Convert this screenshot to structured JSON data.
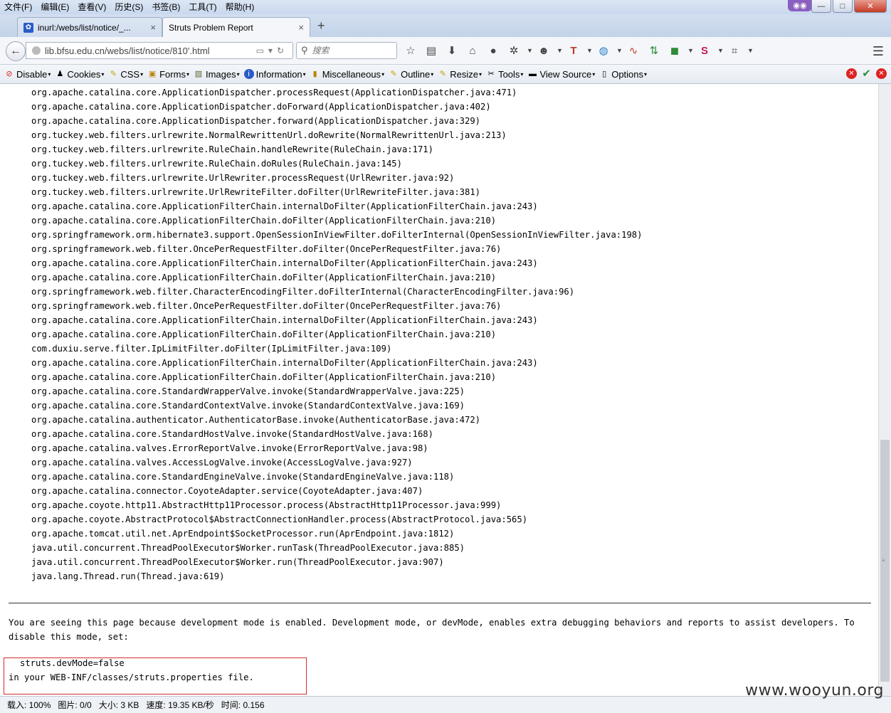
{
  "menu": [
    "文件(F)",
    "编辑(E)",
    "查看(V)",
    "历史(S)",
    "书签(B)",
    "工具(T)",
    "帮助(H)"
  ],
  "tabs": [
    {
      "label": "inurl:/webs/list/notice/_...",
      "close": "×"
    },
    {
      "label": "Struts Problem Report",
      "close": "×"
    }
  ],
  "newtab": "+",
  "address": {
    "url": "lib.bfsu.edu.cn/webs/list/notice/810'.html"
  },
  "search": {
    "placeholder": "搜索"
  },
  "devtoolbar": [
    "Disable",
    "Cookies",
    "CSS",
    "Forms",
    "Images",
    "Information",
    "Miscellaneous",
    "Outline",
    "Resize",
    "Tools",
    "View Source",
    "Options"
  ],
  "stack_trace": [
    "org.apache.catalina.core.ApplicationDispatcher.processRequest(ApplicationDispatcher.java:471)",
    "org.apache.catalina.core.ApplicationDispatcher.doForward(ApplicationDispatcher.java:402)",
    "org.apache.catalina.core.ApplicationDispatcher.forward(ApplicationDispatcher.java:329)",
    "org.tuckey.web.filters.urlrewrite.NormalRewrittenUrl.doRewrite(NormalRewrittenUrl.java:213)",
    "org.tuckey.web.filters.urlrewrite.RuleChain.handleRewrite(RuleChain.java:171)",
    "org.tuckey.web.filters.urlrewrite.RuleChain.doRules(RuleChain.java:145)",
    "org.tuckey.web.filters.urlrewrite.UrlRewriter.processRequest(UrlRewriter.java:92)",
    "org.tuckey.web.filters.urlrewrite.UrlRewriteFilter.doFilter(UrlRewriteFilter.java:381)",
    "org.apache.catalina.core.ApplicationFilterChain.internalDoFilter(ApplicationFilterChain.java:243)",
    "org.apache.catalina.core.ApplicationFilterChain.doFilter(ApplicationFilterChain.java:210)",
    "org.springframework.orm.hibernate3.support.OpenSessionInViewFilter.doFilterInternal(OpenSessionInViewFilter.java:198)",
    "org.springframework.web.filter.OncePerRequestFilter.doFilter(OncePerRequestFilter.java:76)",
    "org.apache.catalina.core.ApplicationFilterChain.internalDoFilter(ApplicationFilterChain.java:243)",
    "org.apache.catalina.core.ApplicationFilterChain.doFilter(ApplicationFilterChain.java:210)",
    "org.springframework.web.filter.CharacterEncodingFilter.doFilterInternal(CharacterEncodingFilter.java:96)",
    "org.springframework.web.filter.OncePerRequestFilter.doFilter(OncePerRequestFilter.java:76)",
    "org.apache.catalina.core.ApplicationFilterChain.internalDoFilter(ApplicationFilterChain.java:243)",
    "org.apache.catalina.core.ApplicationFilterChain.doFilter(ApplicationFilterChain.java:210)",
    "com.duxiu.serve.filter.IpLimitFilter.doFilter(IpLimitFilter.java:109)",
    "org.apache.catalina.core.ApplicationFilterChain.internalDoFilter(ApplicationFilterChain.java:243)",
    "org.apache.catalina.core.ApplicationFilterChain.doFilter(ApplicationFilterChain.java:210)",
    "org.apache.catalina.core.StandardWrapperValve.invoke(StandardWrapperValve.java:225)",
    "org.apache.catalina.core.StandardContextValve.invoke(StandardContextValve.java:169)",
    "org.apache.catalina.authenticator.AuthenticatorBase.invoke(AuthenticatorBase.java:472)",
    "org.apache.catalina.core.StandardHostValve.invoke(StandardHostValve.java:168)",
    "org.apache.catalina.valves.ErrorReportValve.invoke(ErrorReportValve.java:98)",
    "org.apache.catalina.valves.AccessLogValve.invoke(AccessLogValve.java:927)",
    "org.apache.catalina.core.StandardEngineValve.invoke(StandardEngineValve.java:118)",
    "org.apache.catalina.connector.CoyoteAdapter.service(CoyoteAdapter.java:407)",
    "org.apache.coyote.http11.AbstractHttp11Processor.process(AbstractHttp11Processor.java:999)",
    "org.apache.coyote.AbstractProtocol$AbstractConnectionHandler.process(AbstractProtocol.java:565)",
    "org.apache.tomcat.util.net.AprEndpoint$SocketProcessor.run(AprEndpoint.java:1812)",
    "java.util.concurrent.ThreadPoolExecutor$Worker.runTask(ThreadPoolExecutor.java:885)",
    "java.util.concurrent.ThreadPoolExecutor$Worker.run(ThreadPoolExecutor.java:907)",
    "java.lang.Thread.run(Thread.java:619)"
  ],
  "devmode_message": "You are seeing this page because development mode is enabled. Development mode, or devMode, enables extra debugging behaviors and reports to assist developers. To disable this mode, set:",
  "config_line": "struts.devMode=false",
  "config_suffix": "in your WEB-INF/classes/struts.properties file.",
  "status": {
    "load": "载入: 100%",
    "images": "图片: 0/0",
    "size": "大小: 3 KB",
    "speed": "速度: 19.35 KB/秒",
    "time": "时间: 0.156"
  },
  "watermark": "www.wooyun.org"
}
